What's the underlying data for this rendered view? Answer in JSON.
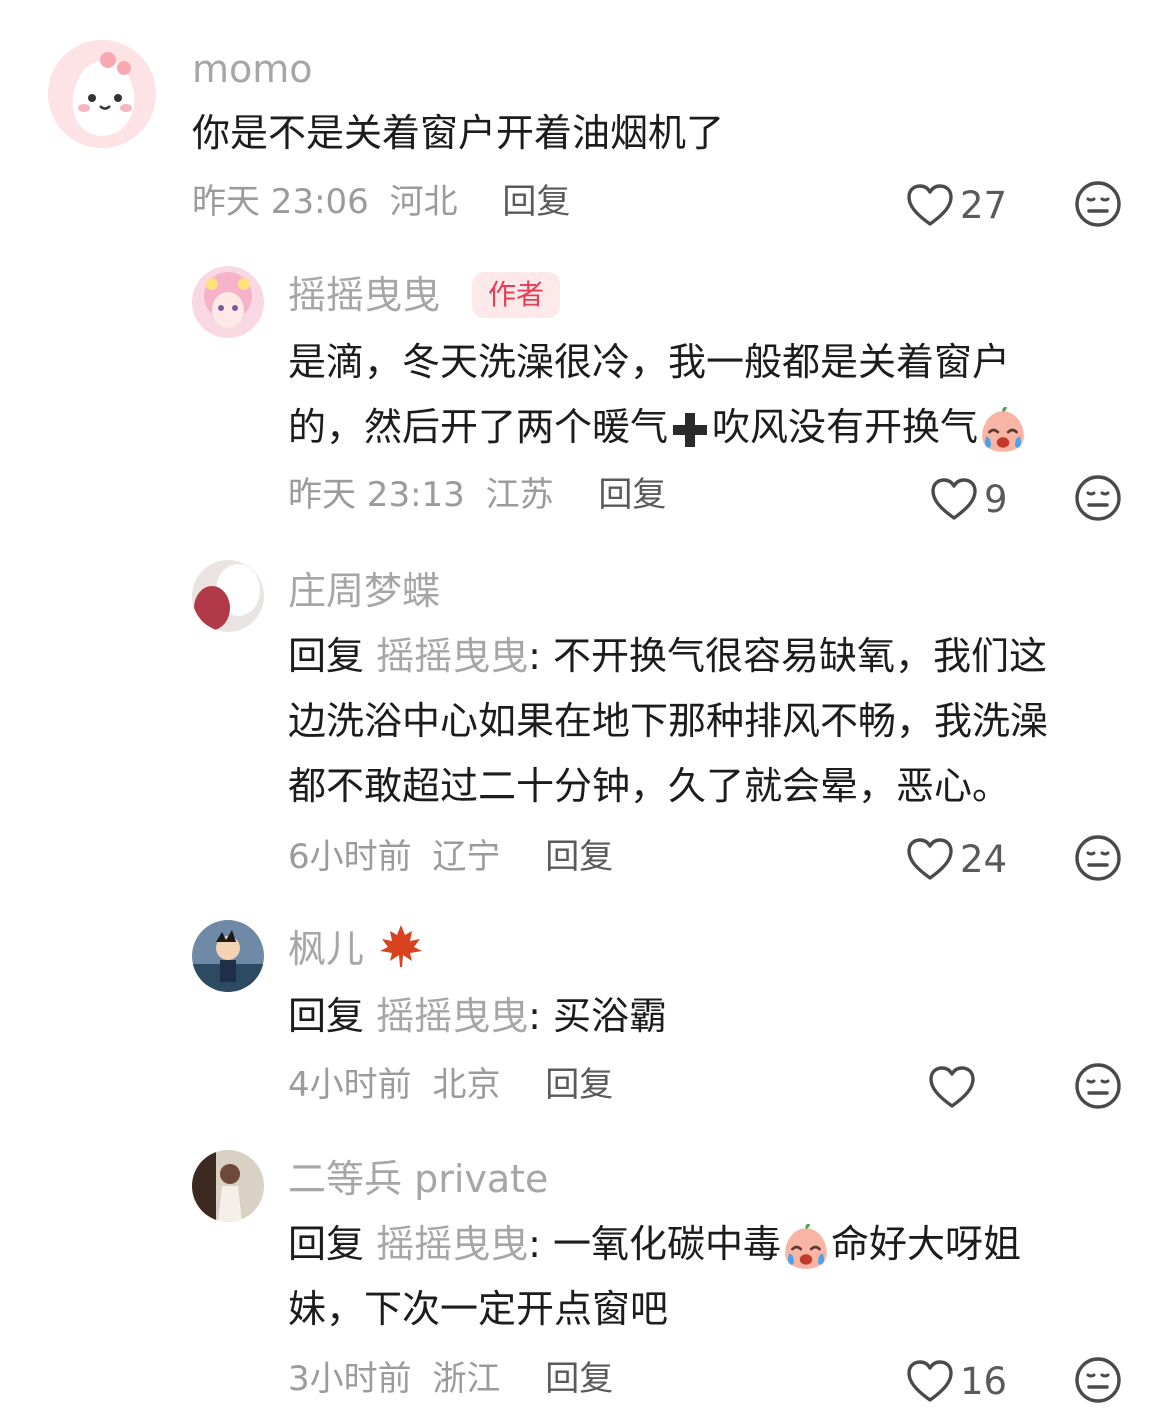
{
  "comments": [
    {
      "username": "momo",
      "text": "你是不是关着窗户开着油烟机了",
      "time": "昨天 23:06",
      "location": "河北",
      "reply_label": "回复",
      "likes": "27"
    },
    {
      "username": "摇摇曳曳",
      "badge": "作者",
      "text_line1": "是滴，冬天洗澡很冷，我一般都是关着窗户",
      "text_line2": "的，然后开了两个暖气",
      "text_line2b": "吹风没有开换气",
      "time": "昨天 23:13",
      "location": "江苏",
      "reply_label": "回复",
      "likes": "9"
    },
    {
      "username": "庄周梦蝶",
      "reply_prefix": "回复 ",
      "reply_target": "摇摇曳曳",
      "text_line1": ": 不开换气很容易缺氧，我们这",
      "text_line2": "边洗浴中心如果在地下那种排风不畅，我洗澡",
      "text_line3": "都不敢超过二十分钟，久了就会晕，恶心。",
      "time": "6小时前",
      "location": "辽宁",
      "reply_label": "回复",
      "likes": "24"
    },
    {
      "username": "枫儿",
      "reply_prefix": "回复 ",
      "reply_target": "摇摇曳曳",
      "text_line1": ": 买浴霸",
      "time": "4小时前",
      "location": "北京",
      "reply_label": "回复",
      "likes": ""
    },
    {
      "username": "二等兵 private",
      "reply_prefix": "回复 ",
      "reply_target": "摇摇曳曳",
      "text_line1a": ": 一氧化碳中毒",
      "text_line1b": "命好大呀姐",
      "text_line2": "妹，下次一定开点窗吧",
      "time": "3小时前",
      "location": "浙江",
      "reply_label": "回复",
      "likes": "16"
    }
  ],
  "icons": {
    "like": "heart-outline-icon",
    "dislike": "meh-face-icon",
    "plus": "heavy-plus-emoji",
    "crying": "crying-peach-emoji",
    "maple": "maple-leaf-emoji"
  },
  "colors": {
    "author_badge_bg": "#fde8ea",
    "author_badge_text": "#ea3b55",
    "muted": "#a6a6a6"
  }
}
